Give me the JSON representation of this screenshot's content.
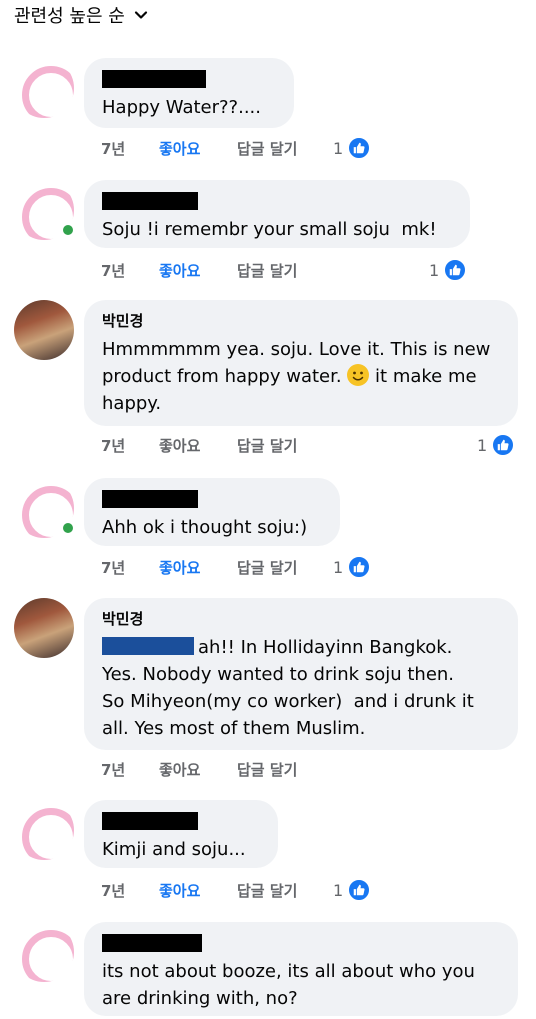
{
  "sort": {
    "label": "관련성 높은 순",
    "icon": "chevron-down-icon"
  },
  "colors": {
    "like_blue": "#1877f2",
    "bubble_bg": "#f0f2f5",
    "meta_gray": "#65676b",
    "online_green": "#31a24c"
  },
  "comments": [
    {
      "name": "",
      "body": "Happy Water??....",
      "time": "7년",
      "like": "좋아요",
      "reply": "답글 달기",
      "reactions": "1",
      "liked": true
    },
    {
      "name": "",
      "body": "Soju !i remembr your small soju  mk!",
      "time": "7년",
      "like": "좋아요",
      "reply": "답글 달기",
      "reactions": "1",
      "liked": true
    },
    {
      "name": "박민경",
      "body_1": "Hmmmmmm yea. soju. Love it. This is new\nproduct from happy water. ",
      "body_2": " it make me\nhappy.",
      "time": "7년",
      "like": "좋아요",
      "reply": "답글 달기",
      "reactions": "1",
      "liked": false
    },
    {
      "name": "",
      "body": "Ahh ok i thought soju:)",
      "time": "7년",
      "like": "좋아요",
      "reply": "답글 달기",
      "reactions": "1",
      "liked": true
    },
    {
      "name": "박민경",
      "body": "ah!! In Hollidayinn Bangkok.\nYes. Nobody wanted to drink soju then.\nSo Mihyeon(my co worker)  and i drunk it\nall. Yes most of them Muslim.",
      "time": "7년",
      "like": "좋아요",
      "reply": "답글 달기",
      "liked": false
    },
    {
      "name": "",
      "body": "Kimji and soju...",
      "time": "7년",
      "like": "좋아요",
      "reply": "답글 달기",
      "reactions": "1",
      "liked": true
    },
    {
      "name": "",
      "body": "its not about booze, its all about who you\nare drinking with, no?"
    }
  ]
}
